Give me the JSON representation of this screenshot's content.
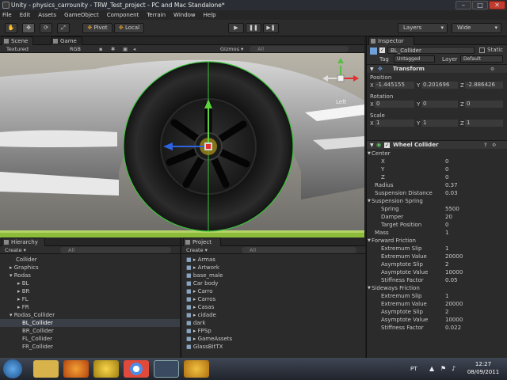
{
  "window": {
    "title": "Unity - physics_carrounity - TRW_Test_project - PC and Mac Standalone*",
    "min": "–",
    "max": "□",
    "close": "✕"
  },
  "menu": [
    "File",
    "Edit",
    "Assets",
    "GameObject",
    "Component",
    "Terrain",
    "Window",
    "Help"
  ],
  "toolbar": {
    "pivot": "Pivot",
    "local": "Local",
    "layers": "Layers",
    "layout": "Wide"
  },
  "scene_tabs": {
    "scene": "Scene",
    "game": "Game"
  },
  "scene_bar": {
    "shading": "Textured",
    "render": "RGB",
    "gizmos": "Gizmos ▾",
    "search": "All"
  },
  "gizmo": {
    "label": "Left"
  },
  "hierarchy": {
    "tab": "Hierarchy",
    "create": "Create ▾",
    "search": "All",
    "items": [
      {
        "label": "Collider",
        "indent": 20
      },
      {
        "label": "▸ Graphics",
        "indent": 12
      },
      {
        "label": "▾ Rodas",
        "indent": 12
      },
      {
        "label": "▸ BL",
        "indent": 22
      },
      {
        "label": "▸ BR",
        "indent": 22
      },
      {
        "label": "▸ FL",
        "indent": 22
      },
      {
        "label": "▸ FR",
        "indent": 22
      },
      {
        "label": "▾ Rodas_Collider",
        "indent": 12
      },
      {
        "label": "BL_Collider",
        "indent": 28,
        "selected": true
      },
      {
        "label": "BR_Collider",
        "indent": 28
      },
      {
        "label": "FL_Collider",
        "indent": 28
      },
      {
        "label": "FR_Collider",
        "indent": 28
      }
    ]
  },
  "project": {
    "tab": "Project",
    "create": "Create ▾",
    "search": "All",
    "items": [
      "▸ Armas",
      "▸ Artwork",
      "base_male",
      "Car body",
      "▸ Carro",
      "▸ Carros",
      "▸ Casas",
      "▸ cidade",
      "dark",
      "▸ FPSp",
      "▸ GameAssets",
      "GlassBitTX"
    ]
  },
  "inspector": {
    "tab": "Inspector",
    "name": "BL_Collider",
    "static": "Static",
    "tag_label": "Tag",
    "tag": "Untagged",
    "layer_label": "Layer",
    "layer": "Default",
    "transform": {
      "title": "Transform",
      "position_label": "Position",
      "position": {
        "x": "-1.445155",
        "y": "0.201696",
        "z": "-2.886426"
      },
      "rotation_label": "Rotation",
      "rotation": {
        "x": "0",
        "y": "0",
        "z": "0"
      },
      "scale_label": "Scale",
      "scale": {
        "x": "1",
        "y": "1",
        "z": "1"
      }
    },
    "wheel": {
      "title": "Wheel Collider",
      "rows": [
        {
          "label": "Center",
          "value": "",
          "indent": 0,
          "header": true
        },
        {
          "label": "X",
          "value": "0",
          "indent": 12
        },
        {
          "label": "Y",
          "value": "0",
          "indent": 12
        },
        {
          "label": "Z",
          "value": "0",
          "indent": 12
        },
        {
          "label": "Radius",
          "value": "0.37",
          "indent": 4
        },
        {
          "label": "Suspension Distance",
          "value": "0.03",
          "indent": 4
        },
        {
          "label": "Suspension Spring",
          "value": "",
          "indent": 0,
          "header": true
        },
        {
          "label": "Spring",
          "value": "5500",
          "indent": 12
        },
        {
          "label": "Damper",
          "value": "20",
          "indent": 12
        },
        {
          "label": "Target Position",
          "value": "0",
          "indent": 12
        },
        {
          "label": "Mass",
          "value": "1",
          "indent": 4
        },
        {
          "label": "Forward Friction",
          "value": "",
          "indent": 0,
          "header": true
        },
        {
          "label": "Extremum Slip",
          "value": "1",
          "indent": 12
        },
        {
          "label": "Extremum Value",
          "value": "20000",
          "indent": 12
        },
        {
          "label": "Asymptote Slip",
          "value": "2",
          "indent": 12
        },
        {
          "label": "Asymptote Value",
          "value": "10000",
          "indent": 12
        },
        {
          "label": "Stiffness Factor",
          "value": "0.05",
          "indent": 12
        },
        {
          "label": "Sideways Friction",
          "value": "",
          "indent": 0,
          "header": true
        },
        {
          "label": "Extremum Slip",
          "value": "1",
          "indent": 12
        },
        {
          "label": "Extremum Value",
          "value": "20000",
          "indent": 12
        },
        {
          "label": "Asymptote Slip",
          "value": "2",
          "indent": 12
        },
        {
          "label": "Asymptote Value",
          "value": "10000",
          "indent": 12
        },
        {
          "label": "Stiffness Factor",
          "value": "0.022",
          "indent": 12
        }
      ]
    }
  },
  "taskbar": {
    "lang": "PT",
    "time": "12:27",
    "date": "08/09/2011"
  }
}
